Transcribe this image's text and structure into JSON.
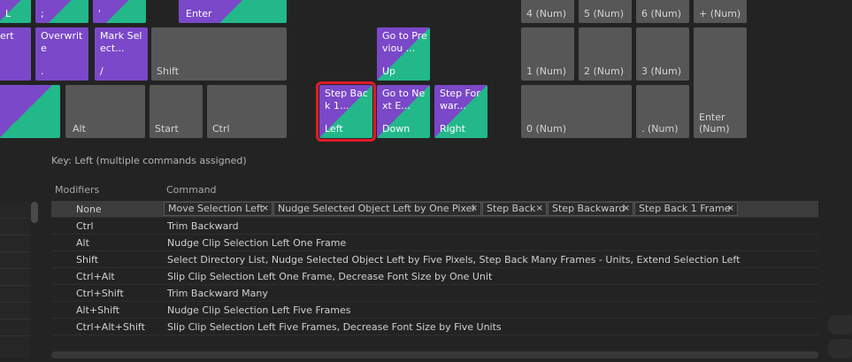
{
  "keyboard": {
    "keys": [
      {
        "name": "key-l",
        "top": "",
        "bottom": "L",
        "style": "split"
      },
      {
        "name": "key-semicolon",
        "top": "",
        "bottom": ";",
        "style": "split"
      },
      {
        "name": "key-apostrophe",
        "top": "",
        "bottom": "'",
        "style": "split"
      },
      {
        "name": "key-enter",
        "top": "",
        "bottom": "Enter",
        "style": "split"
      },
      {
        "name": "key-num4",
        "top": "",
        "bottom": "4 (Num)",
        "style": "gray"
      },
      {
        "name": "key-num5",
        "top": "",
        "bottom": "5 (Num)",
        "style": "gray"
      },
      {
        "name": "key-num6",
        "top": "",
        "bottom": "6 (Num)",
        "style": "gray"
      },
      {
        "name": "key-numplus",
        "top": "",
        "bottom": "+ (Num)",
        "style": "gray"
      },
      {
        "name": "key-m-partial",
        "top": "ert",
        "bottom": "",
        "style": "purple"
      },
      {
        "name": "key-comma",
        "top": "Overwrite",
        "bottom": ".",
        "style": "purple"
      },
      {
        "name": "key-slash",
        "top": "Mark Select...",
        "bottom": "/",
        "style": "purple"
      },
      {
        "name": "key-shift-right",
        "top": "",
        "bottom": "Shift",
        "style": "gray"
      },
      {
        "name": "key-up",
        "top": "Go to Previou ...",
        "bottom": "Up",
        "style": "split"
      },
      {
        "name": "key-num1",
        "top": "",
        "bottom": "1 (Num)",
        "style": "gray"
      },
      {
        "name": "key-num2",
        "top": "",
        "bottom": "2 (Num)",
        "style": "gray"
      },
      {
        "name": "key-num3",
        "top": "",
        "bottom": "3 (Num)",
        "style": "gray"
      },
      {
        "name": "key-numenter",
        "top": "",
        "bottom": "Enter\n(Num)",
        "style": "gray"
      },
      {
        "name": "key-space-partial",
        "top": "",
        "bottom": "",
        "style": "split"
      },
      {
        "name": "key-alt",
        "top": "",
        "bottom": "Alt",
        "style": "gray"
      },
      {
        "name": "key-start",
        "top": "",
        "bottom": "Start",
        "style": "gray"
      },
      {
        "name": "key-ctrl",
        "top": "",
        "bottom": "Ctrl",
        "style": "gray"
      },
      {
        "name": "key-left",
        "top": "Step Back 1...",
        "bottom": "Left",
        "style": "split"
      },
      {
        "name": "key-down",
        "top": "Go to Next E...",
        "bottom": "Down",
        "style": "split"
      },
      {
        "name": "key-right",
        "top": "Step Forwar...",
        "bottom": "Right",
        "style": "split"
      },
      {
        "name": "key-num0",
        "top": "",
        "bottom": "0 (Num)",
        "style": "gray"
      },
      {
        "name": "key-numdot",
        "top": "",
        "bottom": ". (Num)",
        "style": "gray"
      }
    ]
  },
  "key_info": "Key:  Left (multiple commands assigned)",
  "table": {
    "headers": {
      "modifiers": "Modifiers",
      "command": "Command"
    },
    "first_row": {
      "modifier": "None",
      "chips": [
        "Move Selection Left",
        "Nudge Selected Object Left by One Pixel",
        "Step Back",
        "Step Backward",
        "Step Back 1 Frame"
      ]
    },
    "rows": [
      {
        "modifier": "Ctrl",
        "command": "Trim Backward"
      },
      {
        "modifier": "Alt",
        "command": "Nudge Clip Selection Left One Frame"
      },
      {
        "modifier": "Shift",
        "command": "Select Directory List, Nudge Selected Object Left by Five Pixels, Step Back Many Frames - Units, Extend Selection Left"
      },
      {
        "modifier": "Ctrl+Alt",
        "command": "Slip Clip Selection Left One Frame, Decrease Font Size by One Unit"
      },
      {
        "modifier": "Ctrl+Shift",
        "command": "Trim Backward Many"
      },
      {
        "modifier": "Alt+Shift",
        "command": "Nudge Clip Selection Left Five Frames"
      },
      {
        "modifier": "Ctrl+Alt+Shift",
        "command": "Slip Clip Selection Left Five Frames, Decrease Font Size by Five Units"
      }
    ]
  },
  "icons": {
    "remove_chip": "×"
  }
}
